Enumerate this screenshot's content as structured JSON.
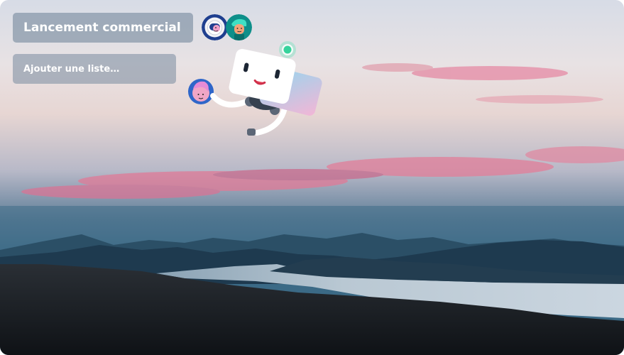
{
  "board": {
    "title": "Lancement commercial",
    "add_list_label": "Ajouter une liste…"
  },
  "members": [
    {
      "name": "member-1",
      "icon": "avatar-astronaut-icon",
      "color": "#1f3f8f"
    },
    {
      "name": "member-2",
      "icon": "avatar-teal-hair-icon",
      "color": "#0e8f8a"
    }
  ],
  "colors": {
    "pill_bg": "#788a9e",
    "sky_top": "#d9dde6",
    "sky_pink": "#e58aa4",
    "mountain": "#1e3a4f",
    "ground": "#15191f"
  }
}
